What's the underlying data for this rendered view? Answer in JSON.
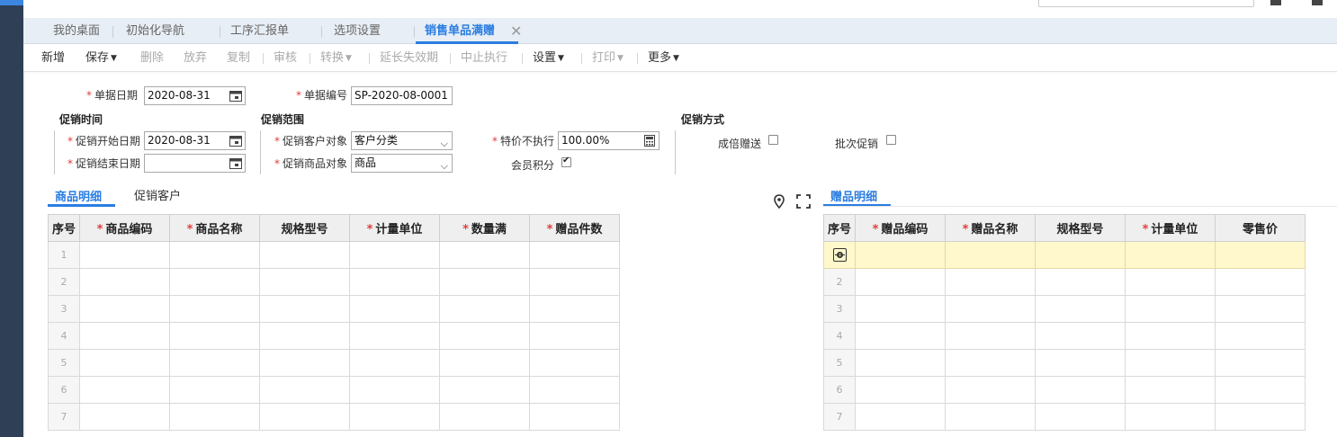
{
  "tabs": [
    {
      "label": "我的桌面",
      "active": false
    },
    {
      "label": "初始化导航",
      "active": false
    },
    {
      "label": "工序汇报单",
      "active": false
    },
    {
      "label": "选项设置",
      "active": false
    },
    {
      "label": "销售单品满赠",
      "active": true
    }
  ],
  "tab_close": "✕",
  "toolbar": {
    "new": "新增",
    "save": "保存",
    "delete": "删除",
    "discard": "放弃",
    "copy": "复制",
    "audit": "审核",
    "convert": "转换",
    "extend": "延长失效期",
    "stop": "中止执行",
    "settings": "设置",
    "print": "打印",
    "more": "更多"
  },
  "form": {
    "doc_date_label": "单据日期",
    "doc_date": "2020-08-31",
    "doc_no_label": "单据编号",
    "doc_no": "SP-2020-08-0001",
    "time_group": "促销时间",
    "start_label": "促销开始日期",
    "start_date": "2020-08-31",
    "end_label": "促销结束日期",
    "end_date": "",
    "scope_group": "促销范围",
    "customer_obj_label": "促销客户对象",
    "customer_obj": "客户分类",
    "goods_obj_label": "促销商品对象",
    "goods_obj": "商品",
    "special_label": "特价不执行",
    "special_value": "100.00%",
    "points_label": "会员积分",
    "points_checked": true,
    "method_group": "促销方式",
    "multiple_label": "成倍赠送",
    "multiple_checked": false,
    "batch_label": "批次促销",
    "batch_checked": false
  },
  "left_tabs": [
    {
      "label": "商品明细",
      "active": true
    },
    {
      "label": "促销客户",
      "active": false
    }
  ],
  "right_tab": "赠品明细",
  "left_table": {
    "headers": [
      {
        "label": "序号",
        "required": false
      },
      {
        "label": "商品编码",
        "required": true
      },
      {
        "label": "商品名称",
        "required": true
      },
      {
        "label": "规格型号",
        "required": false
      },
      {
        "label": "计量单位",
        "required": true
      },
      {
        "label": "数量满",
        "required": true
      },
      {
        "label": "赠品件数",
        "required": true
      }
    ],
    "rows": [
      "1",
      "2",
      "3",
      "4",
      "5",
      "6",
      "7"
    ]
  },
  "right_table": {
    "headers": [
      {
        "label": "序号",
        "required": false
      },
      {
        "label": "赠品编码",
        "required": true
      },
      {
        "label": "赠品名称",
        "required": true
      },
      {
        "label": "规格型号",
        "required": false
      },
      {
        "label": "计量单位",
        "required": true
      },
      {
        "label": "零售价",
        "required": false
      }
    ],
    "rows": [
      "",
      "2",
      "3",
      "4",
      "5",
      "6",
      "7"
    ]
  },
  "colors": {
    "accent": "#2a7de1",
    "required": "#e23c3c",
    "selected_row": "#fff8cc"
  }
}
